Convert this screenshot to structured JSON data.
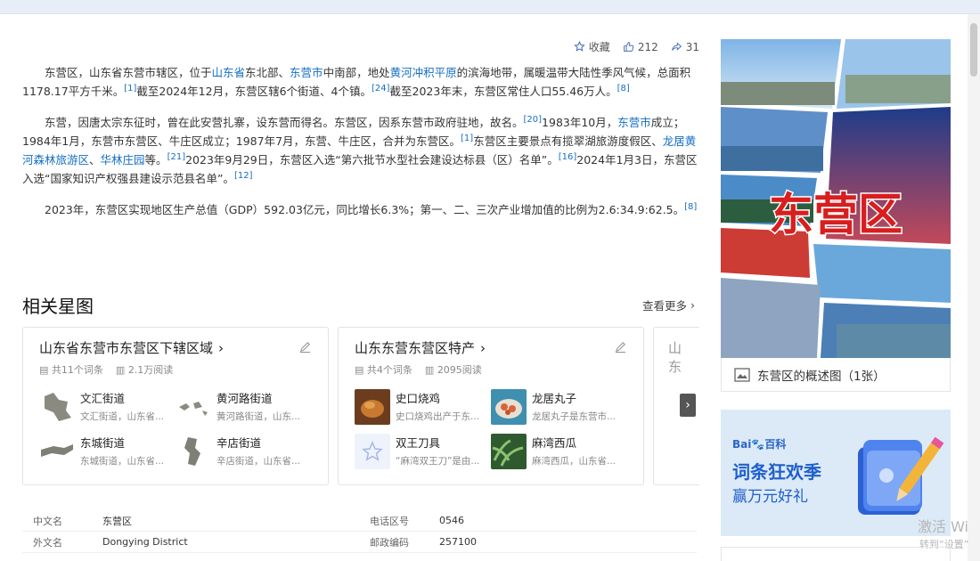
{
  "actions": {
    "collect_label": "收藏",
    "like_count": "212",
    "share_count": "31"
  },
  "paragraphs": {
    "p1": {
      "t1": "东营区，山东省东营市辖区，位于",
      "l1": "山东省",
      "t2": "东北部、",
      "l2": "东营市",
      "t3": "中南部，地处",
      "l3": "黄河冲积平原",
      "t4": "的滨海地带，属暖温带大陆性季风气候，总面积1178.17平方千米。",
      "r1": "[1]",
      "t5": "截至2024年12月，东营区辖6个街道、4个镇。",
      "r2": "[24]",
      "t6": "截至2023年末，东营区常住人口55.46万人。",
      "r3": "[8]"
    },
    "p2": {
      "t1": "东营，因唐太宗东征时，曾在此安营扎寨，设东营而得名。东营区，因系东营市政府驻地，故名。",
      "r1": "[20]",
      "t2": "1983年10月，",
      "l1": "东营市",
      "t3": "成立；1984年1月，东营市东营区、牛庄区成立；1987年7月，东营、牛庄区，合并为东营区。",
      "r2": "[1]",
      "t4": "东营区主要景点有揽翠湖旅游度假区、",
      "l2": "龙居黄河森林旅游区",
      "t5": "、",
      "l3": "华林庄园",
      "t6": "等。",
      "r3": "[21]",
      "t7": "2023年9月29日，东营区入选“第六批节水型社会建设达标县（区）名单”。",
      "r4": "[16]",
      "t8": "2024年1月3日，东营区入选“国家知识产权强县建设示范县名单”。",
      "r5": "[12]"
    },
    "p3": {
      "t1": "2023年，东营区实现地区生产总值（GDP）592.03亿元，同比增长6.3%；第一、二、三次产业增加值的比例为2.6:34.9:62.5。",
      "r1": "[8]"
    }
  },
  "related": {
    "title": "相关星图",
    "more": "查看更多",
    "cards": [
      {
        "title": "山东省东营市东营区下辖区域",
        "entries": "共11个词条",
        "reads": "2.1万阅读",
        "items": [
          {
            "name": "文汇街道",
            "desc": "文汇街道，山东省..."
          },
          {
            "name": "黄河路街道",
            "desc": "黄河路街道，山东..."
          },
          {
            "name": "东城街道",
            "desc": "东城街道，山东省..."
          },
          {
            "name": "辛店街道",
            "desc": "辛店街道，山东省..."
          }
        ]
      },
      {
        "title": "山东东营东营区特产",
        "entries": "共4个词条",
        "reads": "2095阅读",
        "items": [
          {
            "name": "史口烧鸡",
            "desc": "史口烧鸡出产于东..."
          },
          {
            "name": "龙居丸子",
            "desc": "龙居丸子是东营市..."
          },
          {
            "name": "双王刀具",
            "desc": "“麻湾双王刀”是由..."
          },
          {
            "name": "麻湾西瓜",
            "desc": "麻湾西瓜，山东省..."
          }
        ]
      }
    ],
    "partial_title": "山东"
  },
  "info": {
    "rows": [
      {
        "k1": "中文名",
        "v1": "东营区",
        "k2": "电话区号",
        "v2": "0546"
      },
      {
        "k1": "外文名",
        "v1": "Dongying District",
        "k2": "邮政编码",
        "v2": "257100"
      }
    ]
  },
  "sidebar": {
    "image_title": "东营区",
    "caption": "东营区的概述图（1张）"
  },
  "ad": {
    "brand_a": "Bai",
    "brand_b": "百科",
    "title": "词条狂欢季",
    "subtitle": "赢万元好礼"
  },
  "watermark": {
    "line1": "激活 Wi",
    "line2": "转到“设置”"
  },
  "colors": {
    "link": "#136ec2",
    "accent": "#1f5fcc"
  }
}
